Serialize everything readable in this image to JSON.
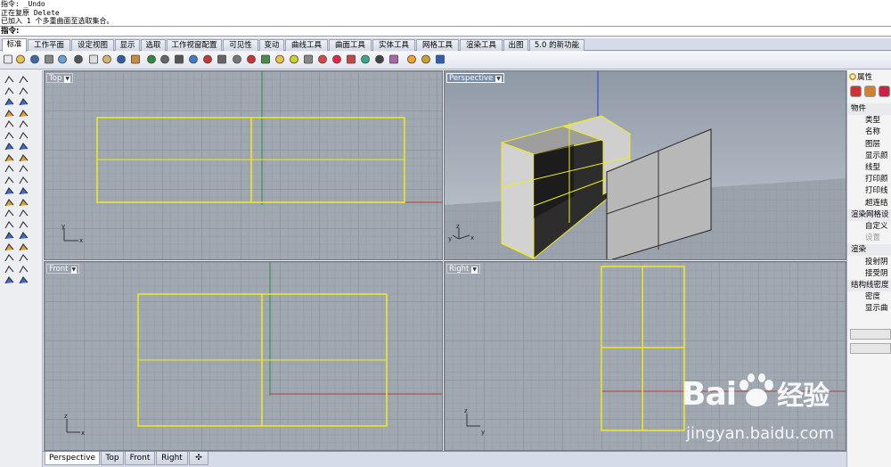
{
  "command_history": [
    "指令: _Undo",
    "正在复原 Delete",
    "已加入 1 个多重曲面至选取集合。"
  ],
  "command_prompt": "指令:",
  "tabs": [
    "标准",
    "工作平面",
    "设定视图",
    "显示",
    "选取",
    "工作视窗配置",
    "可见性",
    "变动",
    "曲线工具",
    "曲面工具",
    "实体工具",
    "网格工具",
    "渲染工具",
    "出图",
    "5.0 的新功能"
  ],
  "active_tab": "标准",
  "viewports": {
    "top": {
      "label": "Top"
    },
    "perspective": {
      "label": "Perspective"
    },
    "front": {
      "label": "Front"
    },
    "right": {
      "label": "Right"
    }
  },
  "axis_labels": {
    "x": "x",
    "y": "y",
    "z": "z"
  },
  "properties_panel": {
    "header_tab": "属性",
    "sections": [
      {
        "title": "物件",
        "items": [
          "类型",
          "名称",
          "图层",
          "显示颜",
          "线型",
          "打印颜",
          "打印线",
          "超连结"
        ]
      },
      {
        "title": "渲染网格设",
        "items": [
          "自定义",
          "设置"
        ]
      },
      {
        "title": "渲染",
        "items": [
          "投射阴",
          "接受阴"
        ]
      },
      {
        "title": "结构线密度",
        "items": [
          "密度",
          "显示曲"
        ]
      }
    ]
  },
  "bottom_tabs": [
    "Perspective",
    "Top",
    "Front",
    "Right",
    "✣"
  ],
  "active_bottom_tab": "Perspective",
  "watermark": {
    "brand": "Bai",
    "brand_cn": "经验",
    "url": "jingyan.baidu.com"
  },
  "colors": {
    "curve_yellow": "#f2ea1e",
    "axis_red": "#b5422e",
    "axis_green": "#2e8b3a",
    "axis_blue": "#2f3fd0",
    "grid_bg": "#a0a8b1"
  }
}
